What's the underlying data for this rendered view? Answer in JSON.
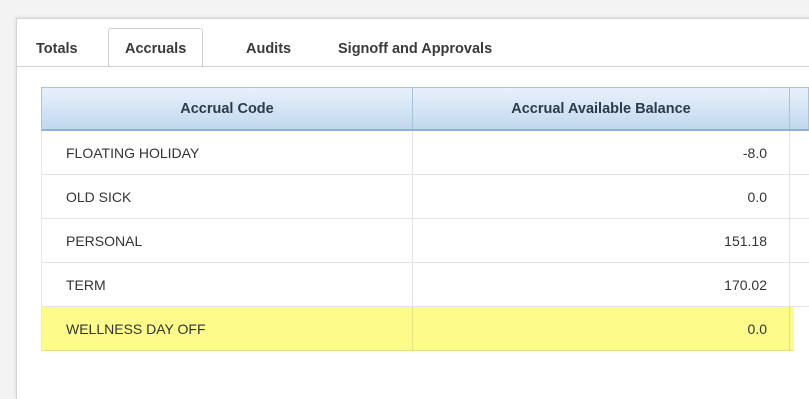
{
  "tabs": [
    {
      "label": "Totals",
      "active": false
    },
    {
      "label": "Accruals",
      "active": true
    },
    {
      "label": "Audits",
      "active": false
    },
    {
      "label": "Signoff and Approvals",
      "active": false
    }
  ],
  "table": {
    "columns": [
      "Accrual Code",
      "Accrual Available Balance"
    ],
    "rows": [
      {
        "code": "FLOATING HOLIDAY",
        "balance": "-8.0"
      },
      {
        "code": "OLD SICK",
        "balance": "0.0"
      },
      {
        "code": "PERSONAL",
        "balance": "151.18"
      },
      {
        "code": "TERM",
        "balance": "170.02"
      },
      {
        "code": "WELLNESS DAY OFF",
        "balance": "0.0",
        "highlighted": true
      }
    ]
  },
  "colors": {
    "highlight": "#fdfb8a",
    "header_top": "#e8f1fb",
    "header_bottom": "#c2d8ee"
  }
}
